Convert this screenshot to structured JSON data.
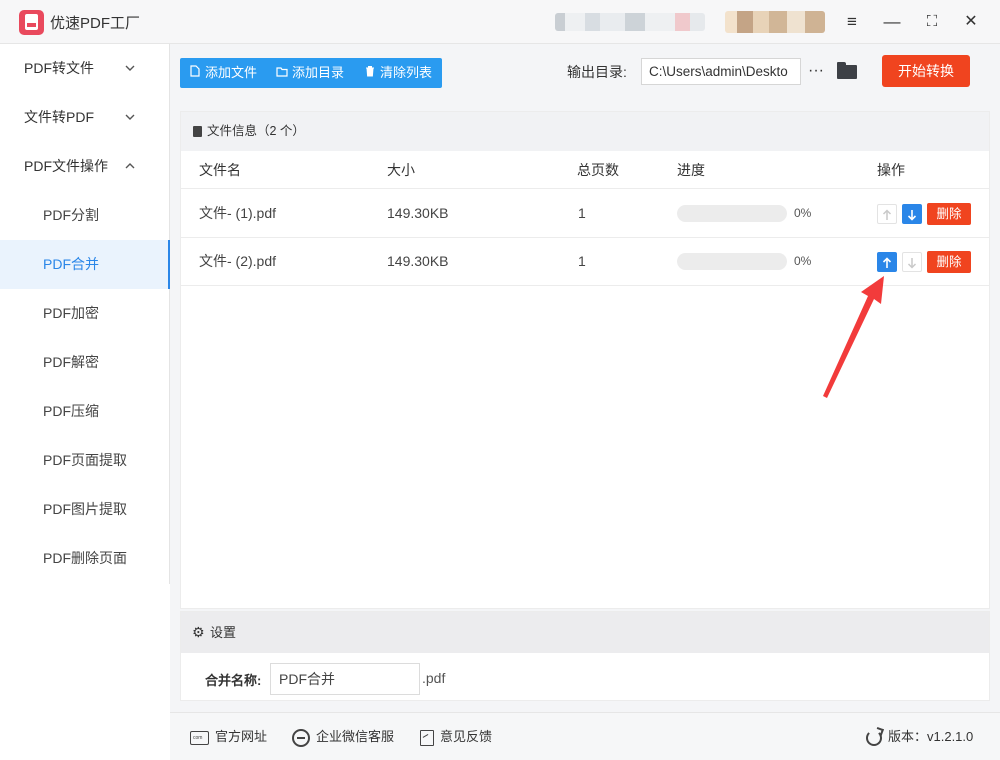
{
  "app": {
    "title": "优速PDF工厂"
  },
  "window_controls": {
    "menu": "≡",
    "minimize": "—",
    "maximize": "⛶",
    "close": "✕"
  },
  "sidebar": {
    "groups": [
      {
        "label": "PDF转文件",
        "expanded": false
      },
      {
        "label": "文件转PDF",
        "expanded": false
      },
      {
        "label": "PDF文件操作",
        "expanded": true
      }
    ],
    "sub_items": [
      "PDF分割",
      "PDF合并",
      "PDF加密",
      "PDF解密",
      "PDF压缩",
      "PDF页面提取",
      "PDF图片提取",
      "PDF删除页面"
    ],
    "active_item": "PDF合并"
  },
  "toolbar": {
    "add_file": "添加文件",
    "add_folder": "添加目录",
    "clear_list": "清除列表",
    "output_label": "输出目录:",
    "output_path": "C:\\Users\\admin\\Deskto",
    "more": "···",
    "start": "开始转换"
  },
  "file_panel": {
    "header": "文件信息（2 个）",
    "columns": {
      "name": "文件名",
      "size": "大小",
      "pages": "总页数",
      "progress": "进度",
      "actions": "操作"
    },
    "rows": [
      {
        "name": "文件- (1).pdf",
        "size": "149.30KB",
        "pages": "1",
        "progress": "0%",
        "progress_value": 0,
        "up_enabled": false,
        "down_enabled": true,
        "delete": "删除"
      },
      {
        "name": "文件- (2).pdf",
        "size": "149.30KB",
        "pages": "1",
        "progress": "0%",
        "progress_value": 0,
        "up_enabled": true,
        "down_enabled": false,
        "delete": "删除"
      }
    ]
  },
  "settings": {
    "header": "设置",
    "merge_label": "合并名称:",
    "merge_name": "PDF合并",
    "merge_ext": ".pdf"
  },
  "footer": {
    "website": "官方网址",
    "wechat": "企业微信客服",
    "feedback": "意见反馈",
    "version": "版本：v1.2.1.0"
  },
  "colors": {
    "accent": "#2a86e8",
    "toolbar_blue": "#2a9bf0",
    "danger": "#f0441f",
    "annotation": "#f23b3b"
  }
}
